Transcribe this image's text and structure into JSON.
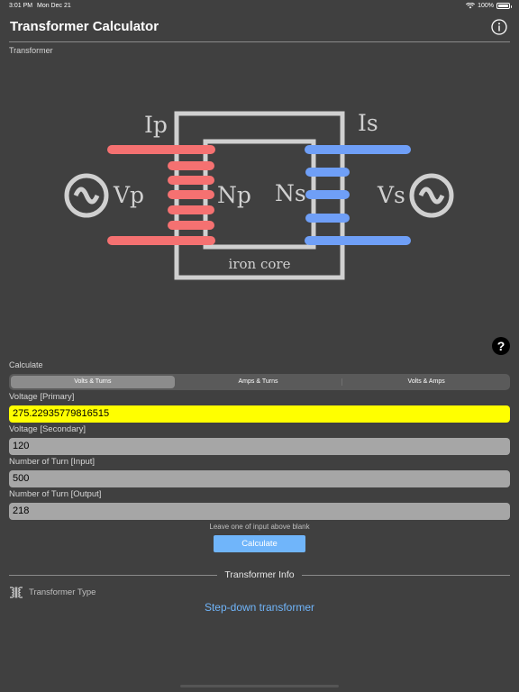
{
  "status_bar": {
    "time": "3:01 PM",
    "date": "Mon Dec 21",
    "battery": "100%"
  },
  "header": {
    "title": "Transformer Calculator",
    "info_icon": "info-circle-icon"
  },
  "diagram": {
    "section_label": "Transformer",
    "labels": {
      "ip": "Ip",
      "is": "Is",
      "vp": "Vp",
      "vs": "Vs",
      "np": "Np",
      "ns": "Ns",
      "core": "iron core"
    },
    "colors": {
      "primary": "#f57171",
      "secondary": "#6f9ff7",
      "core": "#d0d0d0"
    }
  },
  "calculate": {
    "label": "Calculate",
    "tabs": [
      {
        "label": "Volts & Turns",
        "selected": true
      },
      {
        "label": "Amps & Turns",
        "selected": false
      },
      {
        "label": "Volts & Amps",
        "selected": false
      }
    ]
  },
  "fields": [
    {
      "label": "Voltage [Primary]",
      "value": "275.22935779816515",
      "highlighted": true
    },
    {
      "label": "Voltage [Secondary]",
      "value": "120",
      "highlighted": false
    },
    {
      "label": "Number of Turn [Input]",
      "value": "500",
      "highlighted": false
    },
    {
      "label": "Number of Turn [Output]",
      "value": "218",
      "highlighted": false
    }
  ],
  "hint": "Leave one of input above blank",
  "calculate_button": "Calculate",
  "info": {
    "title": "Transformer Info",
    "type_label": "Transformer Type",
    "type_value": "Step-down transformer"
  },
  "colors": {
    "background": "#404040",
    "accent": "#70b5fa",
    "highlight": "#ffff00"
  }
}
